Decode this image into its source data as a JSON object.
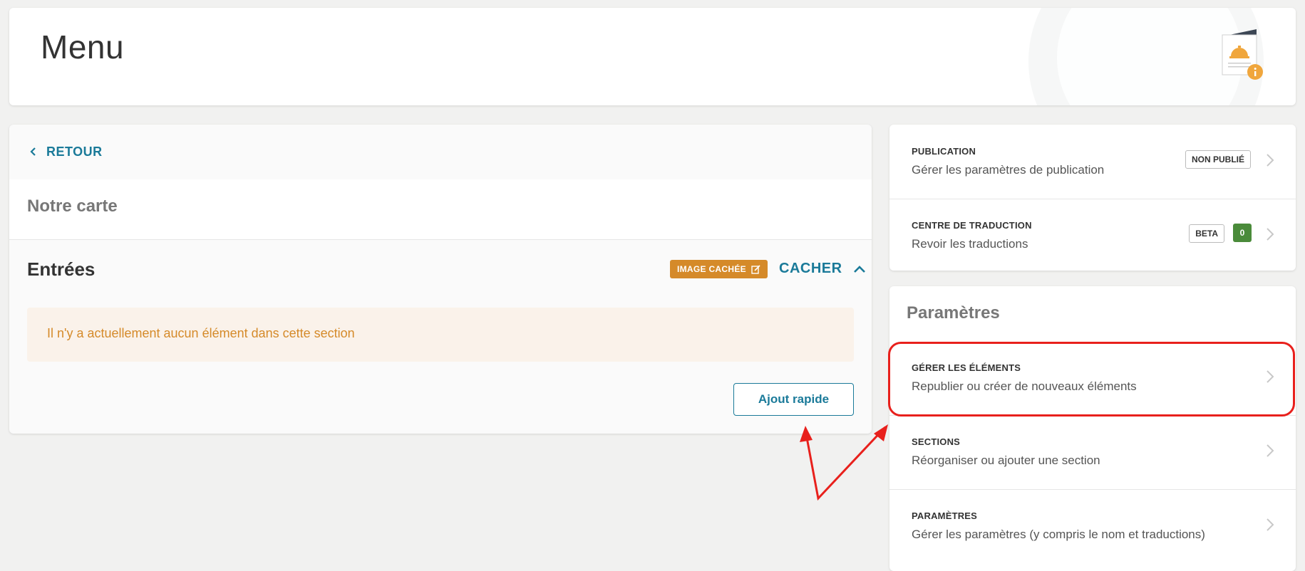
{
  "header": {
    "title": "Menu",
    "icon": "menu-document-icon"
  },
  "main": {
    "back_label": "RETOUR",
    "menu_name": "Notre carte",
    "section": {
      "title": "Entrées",
      "image_badge": "IMAGE CACHÉE",
      "toggle_label": "CACHER",
      "empty_message": "Il n'y a actuellement aucun élément dans cette section",
      "quick_add_label": "Ajout rapide"
    }
  },
  "right_top": {
    "items": [
      {
        "title": "PUBLICATION",
        "description": "Gérer les paramètres de publication",
        "tag": "NON PUBLIÉ"
      },
      {
        "title": "CENTRE DE TRADUCTION",
        "description": "Revoir les traductions",
        "tag": "BETA",
        "count": "0"
      }
    ]
  },
  "settings": {
    "title": "Paramètres",
    "items": [
      {
        "title": "GÉRER LES ÉLÉMENTS",
        "description": "Republier ou créer de nouveaux éléments"
      },
      {
        "title": "SECTIONS",
        "description": "Réorganiser ou ajouter une section"
      },
      {
        "title": "PARAMÈTRES",
        "description": "Gérer les paramètres (y compris le nom et traductions)"
      }
    ]
  },
  "colors": {
    "accent": "#1a7a99",
    "warning": "#d58a29",
    "success": "#4a8b3a",
    "annotation": "#e8201c"
  }
}
